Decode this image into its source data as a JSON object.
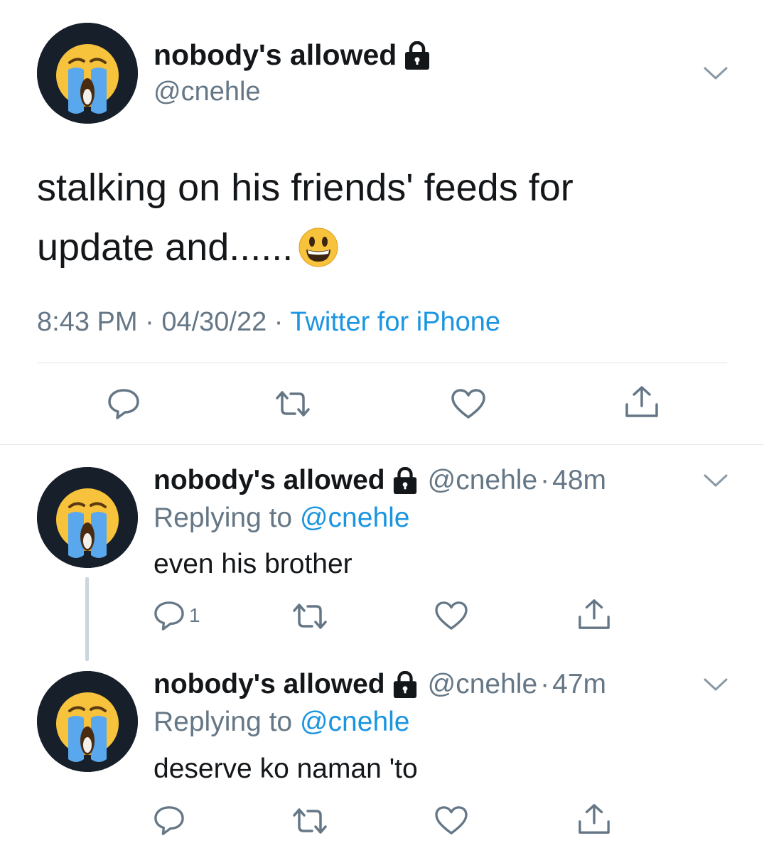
{
  "main_tweet": {
    "display_name": "nobody's allowed",
    "handle": "@cnehle",
    "text_line1": "stalking on his friends' feeds for",
    "text_line2": "update and......",
    "text_emoji": "smiling-face-emoji",
    "time": "8:43 PM",
    "separator": "·",
    "date": "04/30/22",
    "source": "Twitter for iPhone"
  },
  "replies": [
    {
      "display_name": "nobody's allowed",
      "handle": "@cnehle",
      "separator": "·",
      "time": "48m",
      "replying_prefix": "Replying to",
      "replying_to": "@cnehle",
      "text": "even his brother",
      "reply_count": "1"
    },
    {
      "display_name": "nobody's allowed",
      "handle": "@cnehle",
      "separator": "·",
      "time": "47m",
      "replying_prefix": "Replying to",
      "replying_to": "@cnehle",
      "text": "deserve ko naman 'to",
      "reply_count": ""
    }
  ],
  "icons": {
    "avatar": "crying-face-emoji",
    "lock": "lock-icon",
    "menu": "chevron-down-icon",
    "reply": "reply-icon",
    "retweet": "retweet-icon",
    "like": "heart-icon",
    "share": "share-icon"
  },
  "colors": {
    "text": "#14171a",
    "muted": "#657786",
    "link": "#1b95e0",
    "divider": "#e1e8ed",
    "thread_line": "#ccd6dd",
    "avatar_bg": "#17202a"
  }
}
